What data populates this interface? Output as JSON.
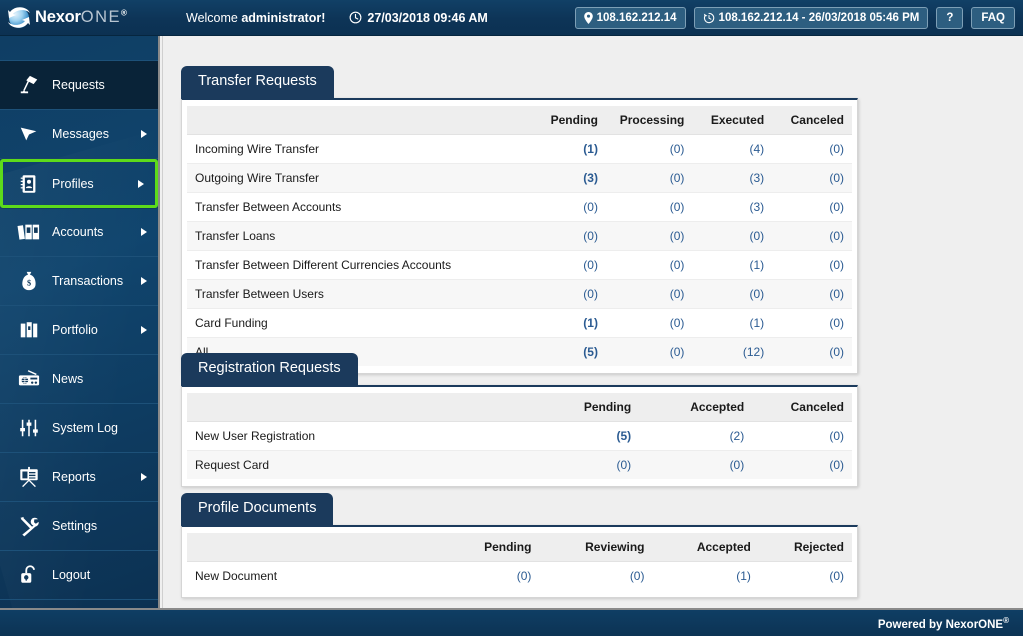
{
  "brand": {
    "logo_name_primary": "Nexor",
    "logo_name_secondary": "ONE",
    "logo_registered": "®",
    "accent_green": "#5ddb1a",
    "navy": "#0d3457",
    "link_blue": "#2b5b92"
  },
  "header": {
    "welcome_prefix": "Welcome ",
    "welcome_user": "administrator!",
    "datetime": "27/03/2018 09:46 AM",
    "clock_icon": "clock-icon",
    "current_ip": "108.162.212.14",
    "current_ip_icon": "location-pin-icon",
    "last_login": "108.162.212.14 - 26/03/2018 05:46 PM",
    "last_login_icon": "history-icon",
    "help_label": "?",
    "faq_label": "FAQ"
  },
  "sidebar": {
    "items": [
      {
        "label": "Requests",
        "icon": "desk-lamp-icon",
        "arrow": false,
        "state": "dark"
      },
      {
        "label": "Messages",
        "icon": "cursor-arrow-icon",
        "arrow": true,
        "state": "normal"
      },
      {
        "label": "Profiles",
        "icon": "address-book-icon",
        "arrow": true,
        "state": "selected"
      },
      {
        "label": "Accounts",
        "icon": "binders-icon",
        "arrow": true,
        "state": "normal"
      },
      {
        "label": "Transactions",
        "icon": "money-bag-icon",
        "arrow": true,
        "state": "normal"
      },
      {
        "label": "Portfolio",
        "icon": "briefcase-icon",
        "arrow": true,
        "state": "normal"
      },
      {
        "label": "News",
        "icon": "radio-icon",
        "arrow": false,
        "state": "normal"
      },
      {
        "label": "System Log",
        "icon": "sliders-icon",
        "arrow": false,
        "state": "normal"
      },
      {
        "label": "Reports",
        "icon": "presentation-icon",
        "arrow": true,
        "state": "normal"
      },
      {
        "label": "Settings",
        "icon": "tools-icon",
        "arrow": false,
        "state": "normal"
      },
      {
        "label": "Logout",
        "icon": "open-lock-icon",
        "arrow": false,
        "state": "normal"
      }
    ]
  },
  "panels": [
    {
      "title": "Transfer Requests",
      "columns": [
        "",
        "Pending",
        "Processing",
        "Executed",
        "Canceled"
      ],
      "rows": [
        {
          "label": "Incoming Wire Transfer",
          "values": [
            "(1)",
            "(0)",
            "(4)",
            "(0)"
          ],
          "bold": [
            true,
            false,
            true,
            false
          ]
        },
        {
          "label": "Outgoing Wire Transfer",
          "values": [
            "(3)",
            "(0)",
            "(3)",
            "(0)"
          ],
          "bold": [
            true,
            false,
            true,
            false
          ]
        },
        {
          "label": "Transfer Between Accounts",
          "values": [
            "(0)",
            "(0)",
            "(3)",
            "(0)"
          ],
          "bold": [
            false,
            false,
            true,
            false
          ]
        },
        {
          "label": "Transfer Loans",
          "values": [
            "(0)",
            "(0)",
            "(0)",
            "(0)"
          ],
          "bold": [
            false,
            false,
            false,
            false
          ]
        },
        {
          "label": "Transfer Between Different Currencies Accounts",
          "values": [
            "(0)",
            "(0)",
            "(1)",
            "(0)"
          ],
          "bold": [
            false,
            false,
            true,
            false
          ]
        },
        {
          "label": "Transfer Between Users",
          "values": [
            "(0)",
            "(0)",
            "(0)",
            "(0)"
          ],
          "bold": [
            false,
            false,
            false,
            false
          ]
        },
        {
          "label": "Card Funding",
          "values": [
            "(1)",
            "(0)",
            "(1)",
            "(0)"
          ],
          "bold": [
            true,
            false,
            true,
            false
          ]
        },
        {
          "label": "All",
          "values": [
            "(5)",
            "(0)",
            "(12)",
            "(0)"
          ],
          "bold": [
            true,
            false,
            true,
            false
          ]
        }
      ]
    },
    {
      "title": "Registration Requests",
      "columns": [
        "",
        "Pending",
        "Accepted",
        "Canceled"
      ],
      "rows": [
        {
          "label": "New User Registration",
          "values": [
            "(5)",
            "(2)",
            "(0)"
          ],
          "bold": [
            true,
            true,
            false
          ]
        },
        {
          "label": "Request Card",
          "values": [
            "(0)",
            "(0)",
            "(0)"
          ],
          "bold": [
            false,
            false,
            false
          ]
        }
      ]
    },
    {
      "title": "Profile Documents",
      "columns": [
        "",
        "Pending",
        "Reviewing",
        "Accepted",
        "Rejected"
      ],
      "rows": [
        {
          "label": "New Document",
          "values": [
            "(0)",
            "(0)",
            "(1)",
            "(0)"
          ],
          "bold": [
            false,
            false,
            true,
            false
          ]
        }
      ]
    }
  ],
  "footer": {
    "powered_by": "Powered by NexorONE",
    "registered": "®"
  }
}
